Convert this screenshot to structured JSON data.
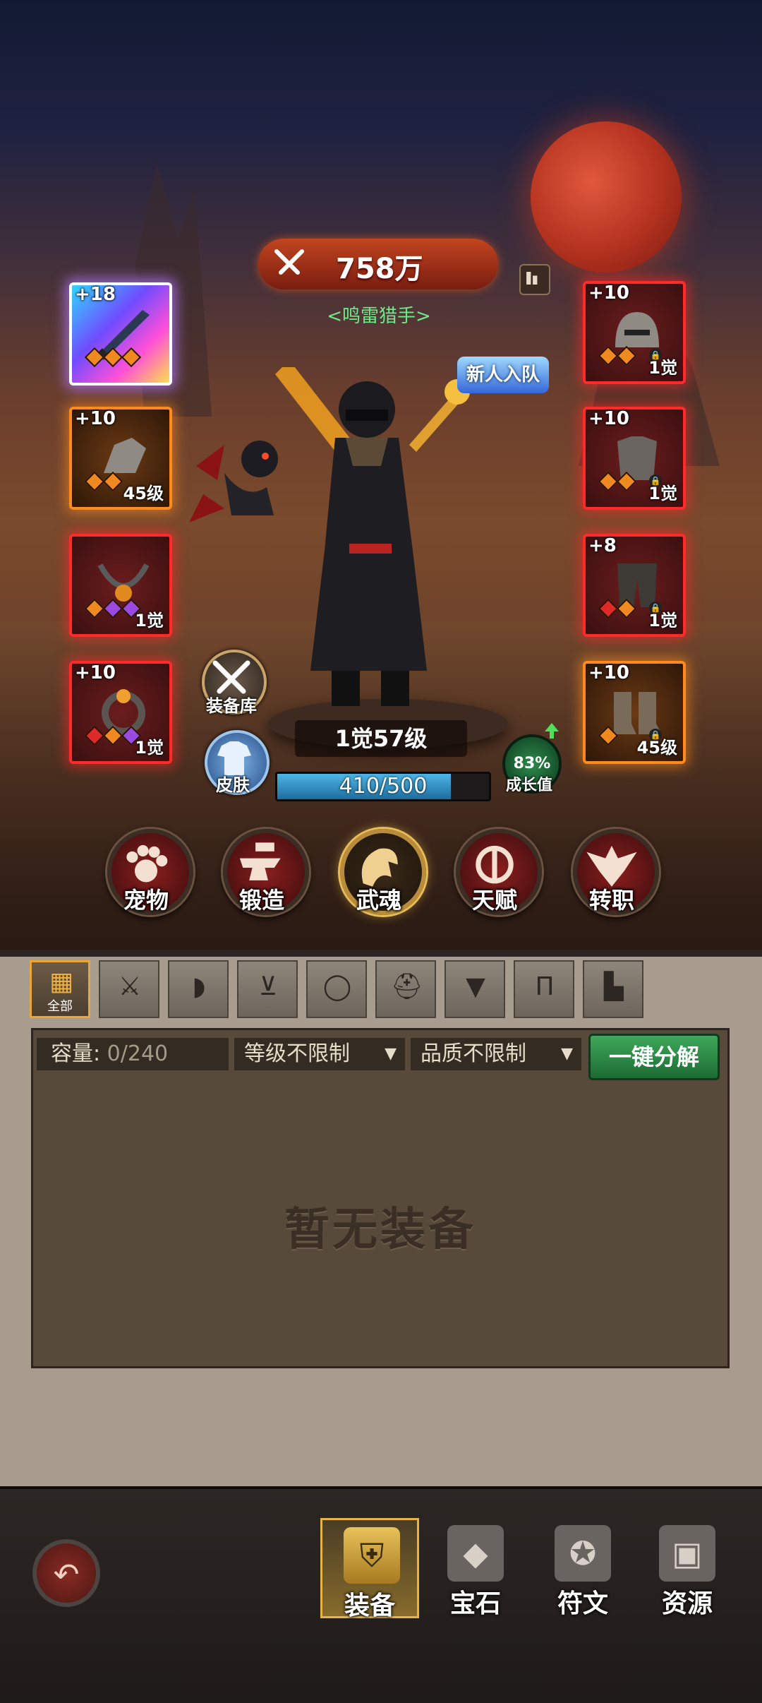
{
  "hero": {
    "power": "758万",
    "title": "<鸣雷猎手>",
    "new_badge": "新人入队",
    "awakening_level": "1觉57级",
    "xp_text": "410/500",
    "xp_progress": 0.82,
    "growth_value": "83%",
    "growth_label": "成长值",
    "equipment_warehouse": "装备库",
    "skin": "皮肤"
  },
  "slots_left": [
    {
      "plus": "+18",
      "level": "",
      "quality": "rainbow",
      "icon": "sword-icon"
    },
    {
      "plus": "+10",
      "level": "45级",
      "quality": "orange",
      "icon": "gauntlet-icon"
    },
    {
      "plus": "",
      "level": "1觉",
      "quality": "red",
      "icon": "necklace-icon"
    },
    {
      "plus": "+10",
      "level": "1觉",
      "quality": "red",
      "icon": "ring-icon"
    }
  ],
  "slots_right": [
    {
      "plus": "+10",
      "level": "1觉",
      "quality": "red",
      "icon": "helmet-icon"
    },
    {
      "plus": "+10",
      "level": "1觉",
      "quality": "red",
      "icon": "armor-icon"
    },
    {
      "plus": "+8",
      "level": "1觉",
      "quality": "red",
      "icon": "pants-icon"
    },
    {
      "plus": "+10",
      "level": "45级",
      "quality": "orange",
      "icon": "boots-icon"
    }
  ],
  "functions": [
    "宠物",
    "锻造",
    "武魂",
    "天赋",
    "转职"
  ],
  "tabs": {
    "all_label": "全部",
    "icons": [
      "grid-icon",
      "sword-icon",
      "shoulder-icon",
      "necklace-icon",
      "ring-icon",
      "helmet-icon",
      "armor-icon",
      "pants-icon",
      "boots-icon"
    ]
  },
  "inventory": {
    "capacity_label": "容量:",
    "capacity_value": "0/240",
    "level_filter": "等级不限制",
    "quality_filter": "品质不限制",
    "decompose_button": "一键分解",
    "empty_text": "暂无装备"
  },
  "bottom_nav": [
    {
      "label": "装备",
      "icon": "armor-nav-icon",
      "active": true
    },
    {
      "label": "宝石",
      "icon": "gem-nav-icon",
      "active": false
    },
    {
      "label": "符文",
      "icon": "rune-nav-icon",
      "active": false
    },
    {
      "label": "资源",
      "icon": "chest-nav-icon",
      "active": false
    }
  ],
  "colors": {
    "red_quality": "#ff2b2b",
    "orange_quality": "#ff8a1f",
    "decompose_green": "#2f8f4a",
    "title_green": "#6fe98a"
  }
}
